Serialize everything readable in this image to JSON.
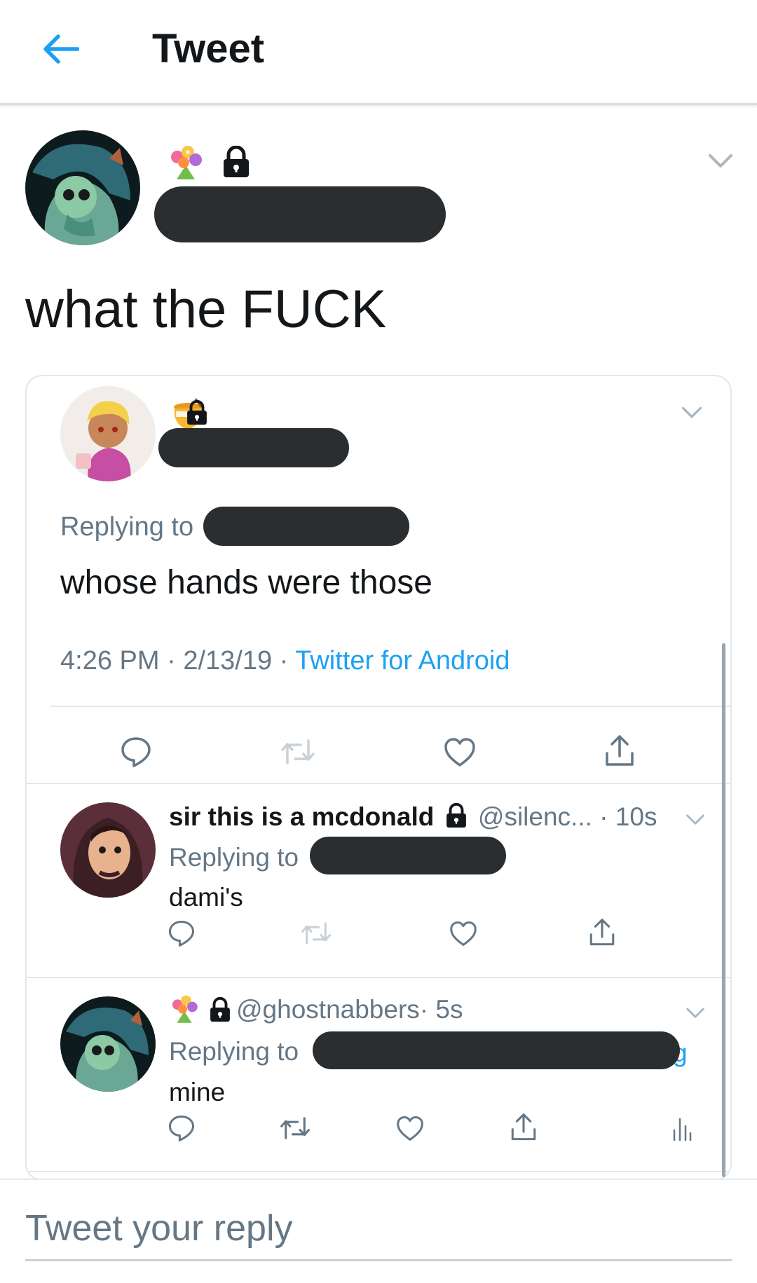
{
  "header": {
    "title": "Tweet",
    "back_icon": "arrow-left-icon",
    "accent": "#1da1f2"
  },
  "main_tweet": {
    "emoji_icon": "bouquet-icon",
    "lock_icon": "lock-icon",
    "text": "what the FUCK"
  },
  "quoted_tweet": {
    "emoji_icon": "honey-pot-icon",
    "replying_label": "Replying to",
    "text": "whose hands were those",
    "time": "4:26 PM",
    "sep1": " · ",
    "date": "2/13/19",
    "sep2": " · ",
    "source": "Twitter for Android"
  },
  "replies": [
    {
      "display_name": "sir this is a mcdonald",
      "handle": "@silenc...",
      "time": " · 10s",
      "replying_label": "Replying to",
      "text": "dami's"
    },
    {
      "handle": "@ghostnabbers",
      "time": " · 5s",
      "replying_label": "Replying to",
      "replying_tail": "g",
      "text": "mine"
    }
  ],
  "reply_box": {
    "placeholder": "Tweet your reply"
  }
}
